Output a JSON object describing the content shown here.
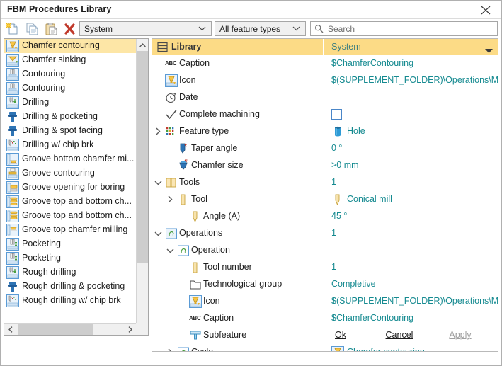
{
  "window": {
    "title": "FBM Procedures Library",
    "close_label": "✕"
  },
  "toolbar": {
    "icons": [
      {
        "name": "new-document-icon",
        "label": "New"
      },
      {
        "name": "copy-icon",
        "label": "Copy"
      },
      {
        "name": "paste-icon",
        "label": "Paste"
      },
      {
        "name": "delete-icon",
        "label": "Delete"
      }
    ],
    "library_select": {
      "value": "System"
    },
    "feature_select": {
      "value": "All feature types"
    },
    "search": {
      "placeholder": "Search",
      "value": ""
    }
  },
  "procedure_list": {
    "selected_index": 0,
    "items": [
      {
        "label": "Chamfer contouring",
        "icon": "chamfer-contouring-icon"
      },
      {
        "label": "Chamfer sinking",
        "icon": "chamfer-sinking-icon"
      },
      {
        "label": "Contouring",
        "icon": "contouring-icon"
      },
      {
        "label": "Contouring",
        "icon": "contouring-icon"
      },
      {
        "label": "Drilling",
        "icon": "drilling-icon"
      },
      {
        "label": "Drilling & pocketing",
        "icon": "drill-pocket-icon"
      },
      {
        "label": "Drilling & spot facing",
        "icon": "drill-spotface-icon"
      },
      {
        "label": "Drilling w/ chip brk",
        "icon": "drill-chipbreak-icon"
      },
      {
        "label": "Groove bottom chamfer mi...",
        "icon": "groove-bottom-chamfer-icon"
      },
      {
        "label": "Groove contouring",
        "icon": "groove-contouring-icon"
      },
      {
        "label": "Groove opening for boring",
        "icon": "groove-opening-icon"
      },
      {
        "label": "Groove top and bottom ch...",
        "icon": "groove-top-bottom-icon"
      },
      {
        "label": "Groove top and bottom ch...",
        "icon": "groove-top-bottom-icon"
      },
      {
        "label": "Groove top chamfer milling",
        "icon": "groove-top-chamfer-icon"
      },
      {
        "label": "Pocketing",
        "icon": "pocketing-icon"
      },
      {
        "label": "Pocketing",
        "icon": "pocketing-icon"
      },
      {
        "label": "Rough drilling",
        "icon": "rough-drilling-icon"
      },
      {
        "label": "Rough drilling & pocketing",
        "icon": "rough-drill-pocket-icon"
      },
      {
        "label": "Rough drilling w/ chip brk",
        "icon": "rough-drill-chip-icon"
      }
    ]
  },
  "tree": {
    "header": {
      "name_label": "Library",
      "value_label": "System",
      "name_icon": "library-icon",
      "dropdown_icon": "chevron-down-icon"
    },
    "rows": [
      {
        "label": "Caption",
        "value": "$ChamferContouring",
        "indent": 0,
        "expander": "none",
        "icon": "abc-icon",
        "value_icon": "none"
      },
      {
        "label": "Icon",
        "value": "$(SUPPLEMENT_FOLDER)\\Operations\\Mill",
        "indent": 0,
        "expander": "none",
        "icon": "chamfer-contouring-icon",
        "value_icon": "none"
      },
      {
        "label": "Date",
        "value": "",
        "indent": 0,
        "expander": "none",
        "icon": "clock-icon",
        "value_icon": "none"
      },
      {
        "label": "Complete machining",
        "value": "",
        "indent": 0,
        "expander": "none",
        "icon": "check-icon",
        "value_icon": "checkbox"
      },
      {
        "label": "Feature type",
        "value": "Hole",
        "indent": 0,
        "expander": "collapsed",
        "icon": "grid-icon",
        "value_icon": "hole-icon"
      },
      {
        "label": "Taper angle",
        "value": "0 °",
        "indent": 1,
        "expander": "none",
        "icon": "taper-icon",
        "value_icon": "none"
      },
      {
        "label": "Chamfer size",
        "value": ">0 mm",
        "indent": 1,
        "expander": "none",
        "icon": "chamfer-size-icon",
        "value_icon": "none"
      },
      {
        "label": "Tools",
        "value": "1",
        "indent": 0,
        "expander": "expanded",
        "icon": "tools-folder-icon",
        "value_icon": "none"
      },
      {
        "label": "Tool",
        "value": "Conical mill",
        "indent": 1,
        "expander": "collapsed",
        "icon": "tool-icon",
        "value_icon": "conical-mill-icon"
      },
      {
        "label": "Angle (A)",
        "value": "45 °",
        "indent": 2,
        "expander": "none",
        "icon": "angle-icon",
        "value_icon": "none"
      },
      {
        "label": "Operations",
        "value": "1",
        "indent": 0,
        "expander": "expanded",
        "icon": "operations-icon",
        "value_icon": "none"
      },
      {
        "label": "Operation",
        "value": "",
        "indent": 1,
        "expander": "expanded",
        "icon": "operation-icon",
        "value_icon": "none"
      },
      {
        "label": "Tool number",
        "value": "1",
        "indent": 2,
        "expander": "none",
        "icon": "tool-icon",
        "value_icon": "none"
      },
      {
        "label": "Technological group",
        "value": "Completive",
        "indent": 2,
        "expander": "none",
        "icon": "folder-icon",
        "value_icon": "none"
      },
      {
        "label": "Icon",
        "value": "$(SUPPLEMENT_FOLDER)\\Operations\\Mill",
        "indent": 2,
        "expander": "none",
        "icon": "chamfer-contouring-icon",
        "value_icon": "none"
      },
      {
        "label": "Caption",
        "value": "$ChamferContouring",
        "indent": 2,
        "expander": "none",
        "icon": "abc-icon",
        "value_icon": "none"
      },
      {
        "label": "Subfeature",
        "value": "",
        "indent": 2,
        "expander": "none",
        "icon": "subfeature-icon",
        "value_icon": "none"
      },
      {
        "label": "Cycle",
        "value": "Chamfer contouring",
        "indent": 1,
        "expander": "collapsed",
        "icon": "operation-icon",
        "value_icon": "chamfer-contouring-icon"
      }
    ]
  },
  "buttons": {
    "ok": "Ok",
    "cancel": "Cancel",
    "apply": "Apply"
  },
  "colors": {
    "header_bg": "#fcdb86",
    "selection_bg": "#fde6a6",
    "value_text": "#158a90",
    "accent_blue": "#4a86c8",
    "delete_red": "#c0392b"
  }
}
